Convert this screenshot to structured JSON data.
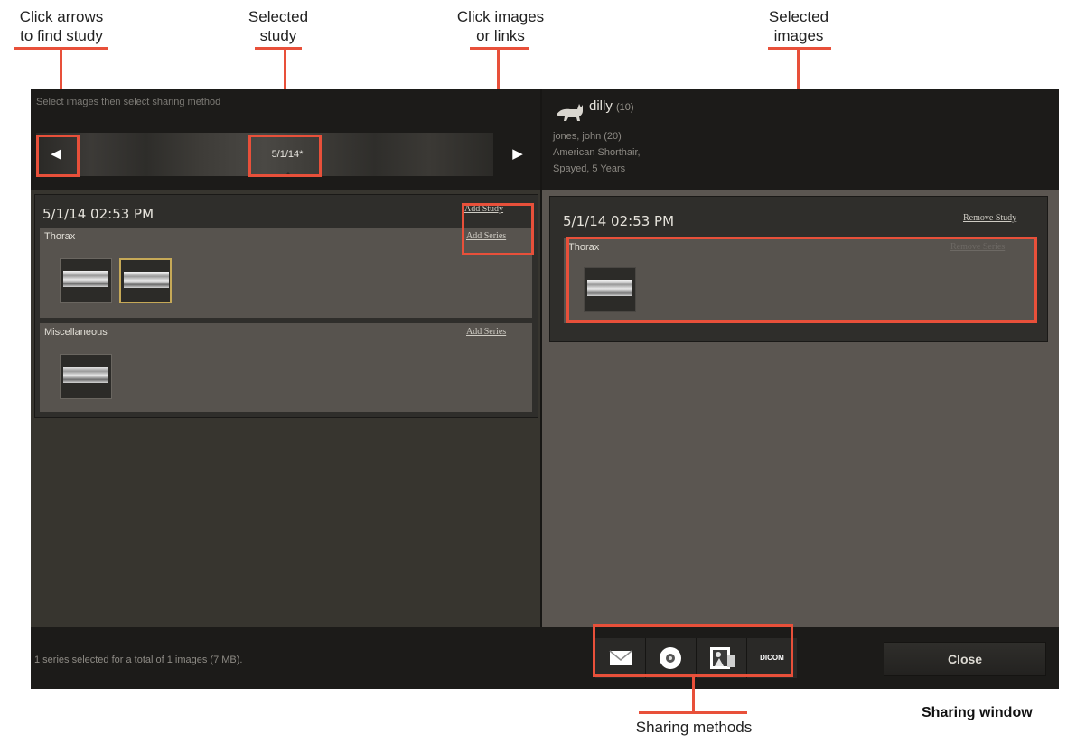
{
  "callouts": {
    "arrows": "Click arrows\nto find study",
    "selected_study": "Selected\nstudy",
    "click_images": "Click images\nor links",
    "selected_images": "Selected\nimages",
    "sharing_methods": "Sharing methods"
  },
  "caption": "Sharing window",
  "topbar": {
    "instruction": "Select images then select sharing method",
    "prev_icon": "left-triangle-icon",
    "next_icon": "right-triangle-icon",
    "selected_study": "5/1/14*"
  },
  "patient": {
    "icon": "cat-icon",
    "name": "dilly",
    "count": "(10)",
    "owner": "jones, john (20)",
    "breed": "American Shorthair,",
    "status": "Spayed, 5 Years"
  },
  "left_study": {
    "date": "5/1/14 02:53 PM",
    "add_study": "Add Study",
    "series": [
      {
        "name": "Thorax",
        "action": "Add Series"
      },
      {
        "name": "Miscellaneous",
        "action": "Add Series"
      }
    ]
  },
  "right_study": {
    "date": "5/1/14 02:53 PM",
    "remove_study": "Remove Study",
    "series": [
      {
        "name": "Thorax",
        "action": "Remove Series"
      }
    ]
  },
  "footer": {
    "status": "1 series selected for a total of 1 images (7 MB).",
    "share_methods": [
      {
        "icon": "envelope-icon"
      },
      {
        "icon": "disc-icon"
      },
      {
        "icon": "print-image-icon"
      },
      {
        "label": "DICOM"
      }
    ],
    "close_label": "Close"
  },
  "colors": {
    "callout_red": "#e8503a",
    "selected_thumb_border": "#c6a957",
    "panel_dark": "#1c1b19"
  }
}
